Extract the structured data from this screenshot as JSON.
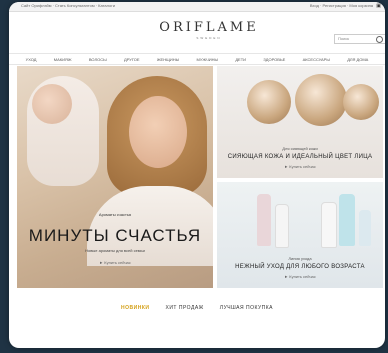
{
  "topbar": {
    "left_text": "Сайт Орифлэйм · Стать Консультантом · Каталоги",
    "right_text": "Вход · Регистрация · Моя корзина",
    "cart_icon": "cart-icon"
  },
  "header": {
    "logo": "ORIFLAME",
    "logo_sub": "SWEDEN",
    "search_placeholder": "Поиск"
  },
  "nav": {
    "items": [
      "УХОД",
      "МАКИЯЖ",
      "ВОЛОСЫ",
      "ДРУГОЕ",
      "ЖЕНЩИНЫ",
      "МУЖЧИНЫ",
      "ДЕТИ",
      "ЗДОРОВЬЕ",
      "АКСЕССУАРЫ",
      "ДЛЯ ДОМА"
    ]
  },
  "hero": {
    "subtitle": "Ароматы счастья",
    "title": "МИНУТЫ СЧАСТЬЯ",
    "caption": "Новые ароматы для всей семьи",
    "link": "► Купить сейчас"
  },
  "promo_top": {
    "caption": "Для сияющей кожи",
    "title": "СИЯЮЩАЯ КОЖА И ИДЕАЛЬНЫЙ ЦВЕТ ЛИЦА",
    "link": "► Купить сейчас"
  },
  "promo_bottom": {
    "caption": "Линия ухода",
    "title": "НЕЖНЫЙ УХОД ДЛЯ ЛЮБОГО ВОЗРАСТА",
    "link": "► Купить сейчас"
  },
  "tabs": {
    "items": [
      "НОВИНКИ",
      "ХИТ ПРОДАЖ",
      "ЛУЧШАЯ ПОКУПКА"
    ],
    "active": 0
  },
  "colors": {
    "accent": "#d4a017",
    "frame": "#1f3344"
  }
}
